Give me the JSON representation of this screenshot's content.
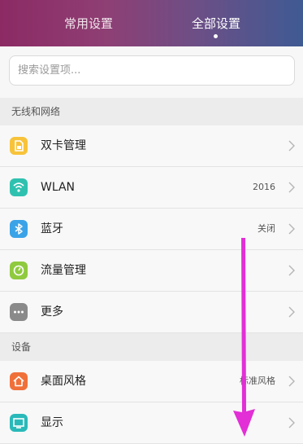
{
  "header": {
    "tabs": [
      {
        "label": "常用设置"
      },
      {
        "label": "全部设置"
      }
    ]
  },
  "search": {
    "placeholder": "搜索设置项..."
  },
  "sections": [
    {
      "title": "无线和网络",
      "items": [
        {
          "label": "双卡管理",
          "value": "",
          "icon": "sim-card-icon",
          "color": "#f7c33a"
        },
        {
          "label": "WLAN",
          "value": "2016",
          "icon": "wifi-icon",
          "color": "#2fc1b0"
        },
        {
          "label": "蓝牙",
          "value": "关闭",
          "icon": "bluetooth-icon",
          "color": "#3aa3e8"
        },
        {
          "label": "流量管理",
          "value": "",
          "icon": "data-usage-icon",
          "color": "#8fca3f"
        },
        {
          "label": "更多",
          "value": "",
          "icon": "more-icon",
          "color": "#8a8a8a"
        }
      ]
    },
    {
      "title": "设备",
      "items": [
        {
          "label": "桌面风格",
          "value": "标准风格",
          "icon": "home-icon",
          "color": "#f0703a"
        },
        {
          "label": "显示",
          "value": "",
          "icon": "display-icon",
          "color": "#2ab9b9"
        }
      ]
    }
  ],
  "annotation": {
    "color": "#e22fd6"
  }
}
